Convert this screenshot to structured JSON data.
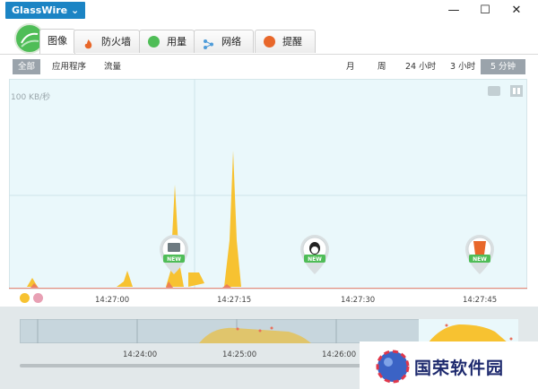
{
  "window": {
    "title": "GlassWire",
    "title_chevron": "⌄",
    "controls": {
      "minimize": "—",
      "maximize": "☐",
      "close": "✕"
    }
  },
  "tabs": [
    {
      "label": "图像",
      "icon": "graph-icon",
      "color": "#4fbd57"
    },
    {
      "label": "防火墙",
      "icon": "flame-icon",
      "color": "#e8672a"
    },
    {
      "label": "用量",
      "icon": "usage-icon",
      "color": "#4fbd57"
    },
    {
      "label": "网络",
      "icon": "network-icon",
      "color": "#4f9cd9"
    },
    {
      "label": "提醒",
      "icon": "alert-icon",
      "color": "#e8672a"
    }
  ],
  "filters": [
    {
      "label": "全部",
      "selected": true
    },
    {
      "label": "应用程序",
      "selected": false
    },
    {
      "label": "流量",
      "selected": false
    }
  ],
  "ranges": [
    {
      "label": "月",
      "selected": false
    },
    {
      "label": "周",
      "selected": false
    },
    {
      "label": "24 小时",
      "selected": false
    },
    {
      "label": "3 小时",
      "selected": false
    },
    {
      "label": "5 分钟",
      "selected": true
    }
  ],
  "chart": {
    "scale_label": "100 KB/秒",
    "time_labels": [
      "14:27:00",
      "14:27:15",
      "14:27:30",
      "14:27:45"
    ],
    "event_pins": [
      {
        "badge": "NEW",
        "icon": "app-icon"
      },
      {
        "badge": "NEW",
        "icon": "qq-icon"
      },
      {
        "badge": "NEW",
        "icon": "html5-icon"
      }
    ],
    "colors": {
      "incoming": "#f7c231",
      "outgoing": "#e8705c",
      "background": "#eaf8fb"
    }
  },
  "overview": {
    "time_labels": [
      "14:24:00",
      "14:25:00",
      "14:26:00"
    ]
  },
  "watermark": "国荣软件园"
}
